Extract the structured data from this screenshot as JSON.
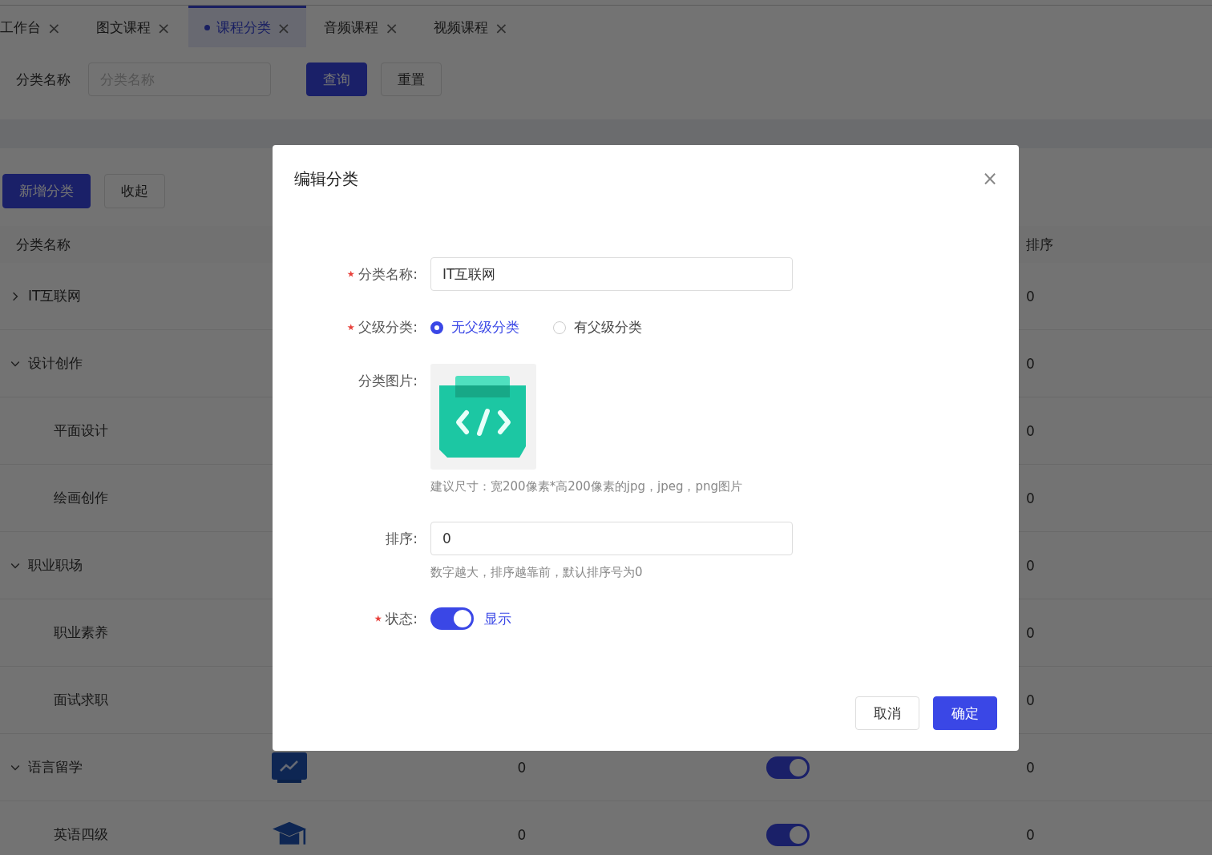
{
  "tabs": [
    {
      "label": "工作台",
      "close": "×",
      "selected": false
    },
    {
      "label": "图文课程",
      "close": "×",
      "selected": false
    },
    {
      "label": "课程分类",
      "close": "×",
      "selected": true
    },
    {
      "label": "音频课程",
      "close": "×",
      "selected": false
    },
    {
      "label": "视频课程",
      "close": "×",
      "selected": false
    }
  ],
  "search": {
    "label": "分类名称",
    "placeholder": "分类名称",
    "query_button": "查询",
    "reset_button": "重置"
  },
  "toolbar": {
    "add_button": "新增分类",
    "collapse_button": "收起"
  },
  "table": {
    "columns": [
      {
        "label": "分类名称"
      },
      {
        "label": "排序"
      }
    ],
    "rows": [
      {
        "name": "IT互联网",
        "expanded": false,
        "sort": "0"
      },
      {
        "name": "设计创作",
        "expanded": true,
        "sort": "0",
        "children": [
          {
            "name": "平面设计",
            "sort": "0"
          },
          {
            "name": "绘画创作",
            "sort": "0"
          }
        ]
      },
      {
        "name": "职业职场",
        "expanded": true,
        "sort": "0",
        "children": [
          {
            "name": "职业素养",
            "sort": "0"
          },
          {
            "name": "面试求职",
            "sort": "0"
          }
        ]
      },
      {
        "name": "语言留学",
        "expanded": true,
        "image": {
          "kind": "chart"
        },
        "count": "0",
        "on": true,
        "sort": "0",
        "children": [
          {
            "name": "英语四级",
            "image": {
              "kind": "cap"
            },
            "count": "0",
            "on": true,
            "sort": "0"
          }
        ]
      }
    ]
  },
  "dialog": {
    "title": "编辑分类",
    "close": "×",
    "name_field": {
      "label": "分类名称:",
      "required": true,
      "value": "IT互联网"
    },
    "parent_field": {
      "label": "父级分类:",
      "required": true,
      "options": [
        {
          "label": "无父级分类",
          "selected": true
        },
        {
          "label": "有父级分类",
          "selected": false
        }
      ]
    },
    "image_field": {
      "label": "分类图片:",
      "hint": "建议尺寸：宽200像素*高200像素的jpg，jpeg，png图片"
    },
    "sort_field": {
      "label": "排序:",
      "value": "0",
      "hint": "数字越大，排序越靠前，默认排序号为0"
    },
    "status_field": {
      "label": "状态:",
      "required": true,
      "on": true,
      "text": "显示"
    },
    "cancel_button": "取消",
    "ok_button": "确定"
  }
}
